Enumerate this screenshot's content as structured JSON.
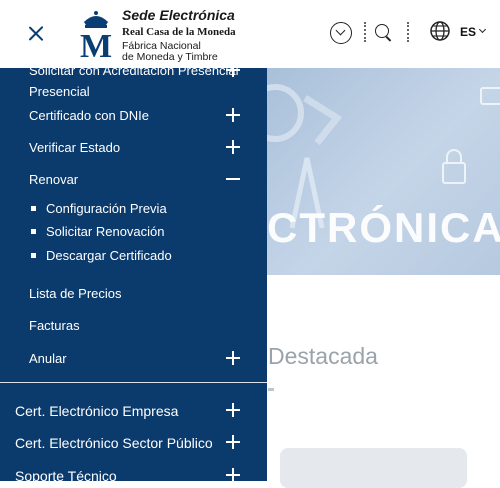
{
  "header": {
    "brand_title": "Sede Electrónica",
    "brand_subtitle": "Real Casa de la Moneda",
    "brand_line3": "Fábrica Nacional",
    "brand_line4": "de Moneda y Timbre",
    "language": "ES",
    "icons": [
      "close-icon",
      "logo-emblem",
      "chevron-circle-icon",
      "search-icon",
      "globe-icon",
      "chevron-down-icon"
    ]
  },
  "menu": {
    "partial_item": "Solicitar con Acreditación Presencial",
    "partial_item_line2": "Presencial",
    "items": [
      {
        "label": "Certificado con DNIe",
        "state": "collapsed"
      },
      {
        "label": "Verificar Estado",
        "state": "collapsed"
      },
      {
        "label": "Renovar",
        "state": "expanded"
      },
      {
        "label": "Lista de Precios"
      },
      {
        "label": "Facturas"
      },
      {
        "label": "Anular",
        "state": "collapsed"
      }
    ],
    "renovar_sub": [
      {
        "label": "Configuración Previa"
      },
      {
        "label": "Solicitar Renovación"
      },
      {
        "label": "Descargar Certificado"
      }
    ],
    "top_items": [
      {
        "label": "Cert. Electrónico Empresa"
      },
      {
        "label": "Cert. Electrónico Sector Público"
      },
      {
        "label": "Soporte Técnico"
      }
    ]
  },
  "background": {
    "hero_text": "CTRÓNICA",
    "section_title": "Destacada"
  },
  "colors": {
    "panel": "#0b3a6c",
    "brand": "#0a3e73"
  }
}
